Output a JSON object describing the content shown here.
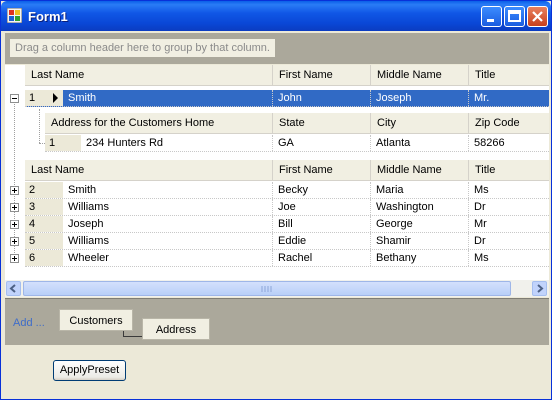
{
  "window": {
    "title": "Form1"
  },
  "groupby": {
    "hint": "Drag a column header here to group by that column."
  },
  "grid": {
    "columns": [
      "Last Name",
      "First Name",
      "Middle Name",
      "Title"
    ],
    "selected_row": {
      "num": "1",
      "cells": [
        "Smith",
        "John",
        "Joseph",
        "Mr."
      ]
    },
    "child": {
      "columns": [
        "Address for the Customers Home",
        "State",
        "City",
        "Zip Code"
      ],
      "row": {
        "num": "1",
        "cells": [
          "234 Hunters Rd",
          "GA",
          "Atlanta",
          "58266"
        ]
      }
    },
    "rows": [
      {
        "num": "2",
        "cells": [
          "Smith",
          "Becky",
          "Maria",
          "Ms"
        ]
      },
      {
        "num": "3",
        "cells": [
          "Williams",
          "Joe",
          "Washington",
          "Dr"
        ]
      },
      {
        "num": "4",
        "cells": [
          "Joseph",
          "Bill",
          "George",
          "Mr"
        ]
      },
      {
        "num": "5",
        "cells": [
          "Williams",
          "Eddie",
          "Shamir",
          "Dr"
        ]
      },
      {
        "num": "6",
        "cells": [
          "Wheeler",
          "Rachel",
          "Bethany",
          "Ms"
        ]
      }
    ]
  },
  "bands": {
    "add_label": "Add ...",
    "parent": "Customers",
    "child": "Address"
  },
  "apply_button": "ApplyPreset"
}
